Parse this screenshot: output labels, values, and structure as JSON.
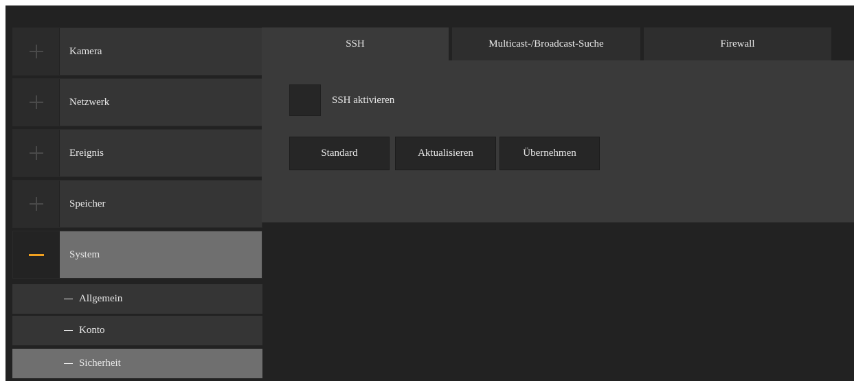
{
  "sidebar": {
    "items": [
      {
        "label": "Kamera",
        "expanded": false
      },
      {
        "label": "Netzwerk",
        "expanded": false
      },
      {
        "label": "Ereignis",
        "expanded": false
      },
      {
        "label": "Speicher",
        "expanded": false
      },
      {
        "label": "System",
        "expanded": true
      }
    ],
    "subitems": [
      {
        "label": "Allgemein",
        "active": false
      },
      {
        "label": "Konto",
        "active": false
      },
      {
        "label": "Sicherheit",
        "active": true
      }
    ]
  },
  "tabs": [
    {
      "label": "SSH",
      "active": true
    },
    {
      "label": "Multicast-/Broadcast-Suche",
      "active": false
    },
    {
      "label": "Firewall",
      "active": false
    }
  ],
  "panel": {
    "checkbox_label": "SSH aktivieren",
    "checked": false,
    "buttons": [
      "Standard",
      "Aktualisieren",
      "Übernehmen"
    ]
  },
  "colors": {
    "accent": "#f0a020",
    "background": "#222222",
    "active_item": "#6f6f6f"
  },
  "icons": [
    "plus-icon",
    "minus-icon"
  ]
}
